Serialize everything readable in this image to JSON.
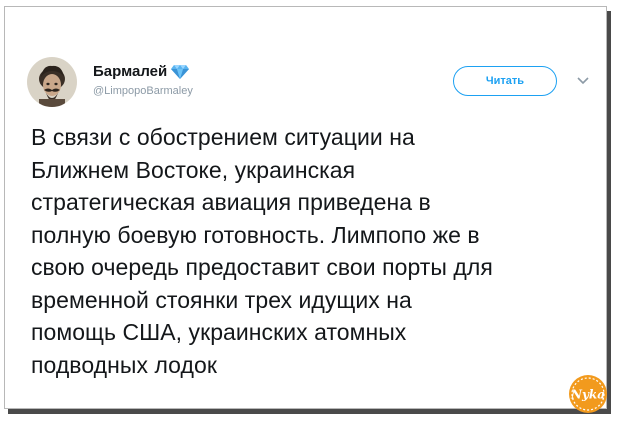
{
  "tweet": {
    "display_name": "Бармалей",
    "handle": "@LimpopoBarmaley",
    "follow_label": "Читать",
    "text_lines": [
      "В связи с обострением ситуации на",
      "Ближнем Востоке, украинская",
      "стратегическая авиация приведена в",
      "полную боевую готовность. Лимпопо же в",
      "свою очередь предоставит свои порты для",
      "временной стоянки трех идущих на",
      "помощь США, украинских атомных",
      "подводных лодок"
    ]
  },
  "icons": {
    "verified": "diamond-icon",
    "menu": "chevron-down-icon",
    "watermark": "site-logo"
  },
  "watermark": {
    "text": "Nyka"
  },
  "colors": {
    "accent": "#1da1f2",
    "handle_text": "#8c9aa6",
    "body_text": "#14171a",
    "watermark_orange": "#f29a1d"
  }
}
